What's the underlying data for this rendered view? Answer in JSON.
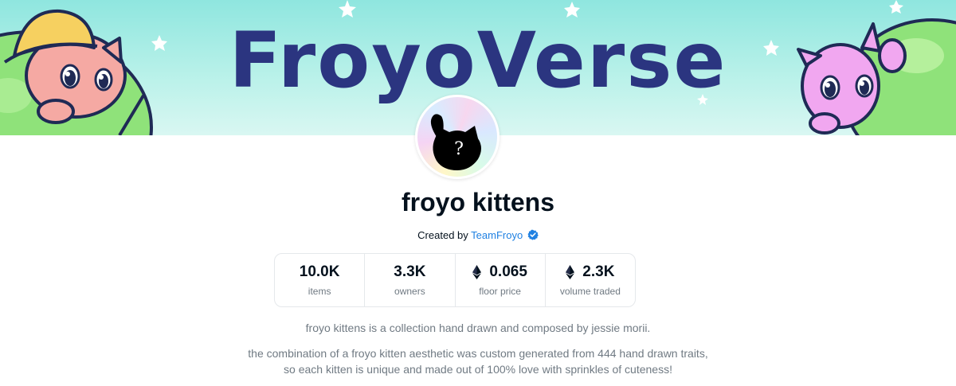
{
  "banner": {
    "title": "FroyoVerse",
    "colors": {
      "sky": "#8fe6df",
      "title": "#2b3580",
      "star": "#ffffff",
      "hill": "#8fe27a",
      "kitten_left": "#f5a9a3",
      "hat": "#f6d060",
      "kitten_right": "#f1a7f0"
    },
    "icons": [
      "star-icon",
      "kitten-illustration-left",
      "kitten-illustration-right",
      "green-planet"
    ]
  },
  "collection": {
    "avatar_icon": "kitten-silhouette-question-mark",
    "avatar_glyph": "?",
    "title": "froyo kittens",
    "created_by_label": "Created by",
    "creator_name": "TeamFroyo",
    "verified_icon": "verified-badge-icon"
  },
  "stats": [
    {
      "value": "10.0K",
      "label": "items",
      "icon": ""
    },
    {
      "value": "3.3K",
      "label": "owners",
      "icon": ""
    },
    {
      "value": "0.065",
      "label": "floor price",
      "icon": "ethereum-icon"
    },
    {
      "value": "2.3K",
      "label": "volume traded",
      "icon": "ethereum-icon"
    }
  ],
  "description": {
    "paragraph_1": "froyo kittens is a collection hand drawn and composed by jessie morii.",
    "paragraph_2_line_1": "the combination of a froyo kitten aesthetic was custom generated from 444 hand drawn traits,",
    "paragraph_2_line_2": "so each kitten is unique and made out of 100% love with sprinkles of cuteness!"
  },
  "theme": {
    "text_primary": "#04111d",
    "text_secondary": "#707a83",
    "link": "#2081e2",
    "border": "#e5e8eb"
  }
}
